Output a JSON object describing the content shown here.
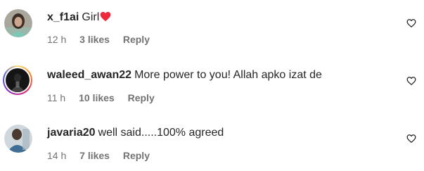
{
  "comments": [
    {
      "username": "x_f1ai",
      "text": "Girl",
      "emoji": "red-heart-emoji",
      "time": "12 h",
      "likes": "3 likes",
      "reply": "Reply",
      "avatar": "avatar-photo-girl-teal"
    },
    {
      "username": "waleed_awan22",
      "text": "More power to you! Allah apko izat de",
      "time": "11 h",
      "likes": "10 likes",
      "reply": "Reply",
      "avatar": "avatar-photo-dark-story-ring"
    },
    {
      "username": "javaria20",
      "text": "well said.....100% agreed",
      "time": "14 h",
      "likes": "7 likes",
      "reply": "Reply",
      "avatar": "avatar-photo-person-blue"
    }
  ],
  "icons": {
    "like": "heart-outline-icon"
  },
  "colors": {
    "text": "#262626",
    "meta": "#737373",
    "heart": "#ed4956"
  }
}
